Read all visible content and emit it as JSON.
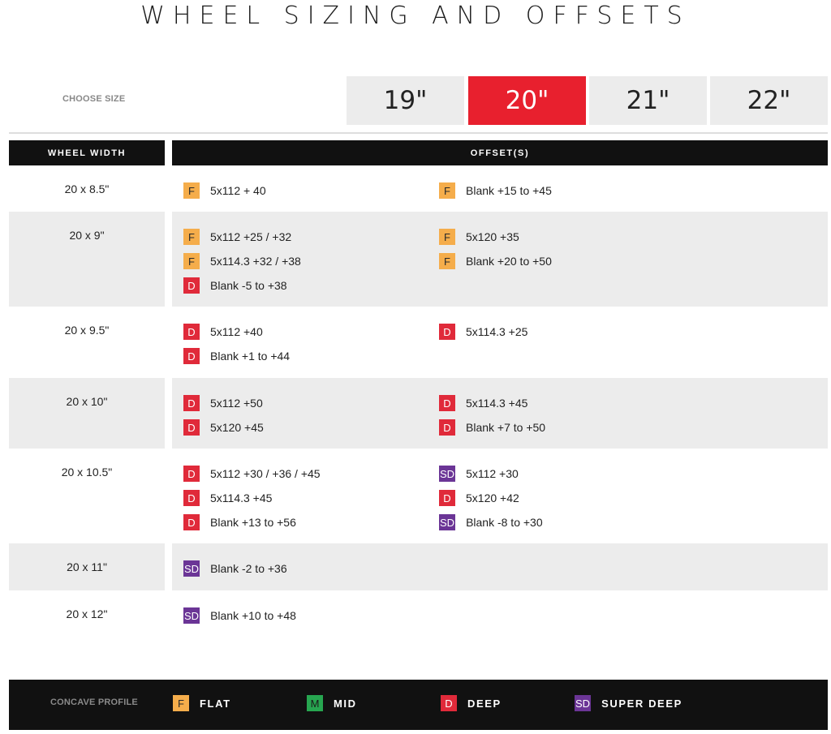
{
  "page_title": "WHEEL SIZING AND OFFSETS",
  "size_selector": {
    "label": "CHOOSE SIZE",
    "options": [
      "19\"",
      "20\"",
      "21\"",
      "22\""
    ],
    "selected": "20\""
  },
  "table": {
    "headers": {
      "width": "WHEEL WIDTH",
      "offsets": "OFFSET(S)"
    },
    "rows": [
      {
        "width": "20 x 8.5\"",
        "left": [
          {
            "badge": "F",
            "text": "5x112 + 40"
          }
        ],
        "right": [
          {
            "badge": "F",
            "text": "Blank +15 to +45"
          }
        ]
      },
      {
        "width": "20 x 9\"",
        "left": [
          {
            "badge": "F",
            "text": "5x112 +25 / +32"
          },
          {
            "badge": "F",
            "text": "5x114.3 +32 / +38"
          },
          {
            "badge": "D",
            "text": "Blank -5 to +38"
          }
        ],
        "right": [
          {
            "badge": "F",
            "text": "5x120 +35"
          },
          {
            "badge": "F",
            "text": "Blank +20 to +50"
          }
        ]
      },
      {
        "width": "20 x 9.5\"",
        "left": [
          {
            "badge": "D",
            "text": "5x112 +40"
          },
          {
            "badge": "D",
            "text": "Blank +1 to +44"
          }
        ],
        "right": [
          {
            "badge": "D",
            "text": "5x114.3 +25"
          }
        ]
      },
      {
        "width": "20 x 10\"",
        "left": [
          {
            "badge": "D",
            "text": "5x112 +50"
          },
          {
            "badge": "D",
            "text": "5x120 +45"
          }
        ],
        "right": [
          {
            "badge": "D",
            "text": "5x114.3 +45"
          },
          {
            "badge": "D",
            "text": "Blank +7 to +50"
          }
        ]
      },
      {
        "width": "20 x 10.5\"",
        "left": [
          {
            "badge": "D",
            "text": "5x112 +30 / +36 / +45"
          },
          {
            "badge": "D",
            "text": "5x114.3 +45"
          },
          {
            "badge": "D",
            "text": "Blank +13 to +56"
          }
        ],
        "right": [
          {
            "badge": "SD",
            "text": "5x112 +30"
          },
          {
            "badge": "D",
            "text": "5x120 +42"
          },
          {
            "badge": "SD",
            "text": "Blank -8 to +30"
          }
        ]
      },
      {
        "width": "20 x 11\"",
        "left": [
          {
            "badge": "SD",
            "text": "Blank -2 to +36"
          }
        ],
        "right": []
      },
      {
        "width": "20 x 12\"",
        "left": [
          {
            "badge": "SD",
            "text": "Blank +10 to +48"
          }
        ],
        "right": []
      }
    ]
  },
  "legend": {
    "label": "CONCAVE PROFILE",
    "items": [
      {
        "badge": "F",
        "name": "FLAT"
      },
      {
        "badge": "M",
        "name": "MID"
      },
      {
        "badge": "D",
        "name": "DEEP"
      },
      {
        "badge": "SD",
        "name": "SUPER DEEP"
      }
    ]
  },
  "colors": {
    "accent": "#e8202e",
    "flat": "#f5ad4b",
    "mid": "#27a650",
    "deep": "#e02a3a",
    "super_deep": "#6b3596",
    "header_bg": "#111111",
    "row_shade": "#ececec"
  }
}
